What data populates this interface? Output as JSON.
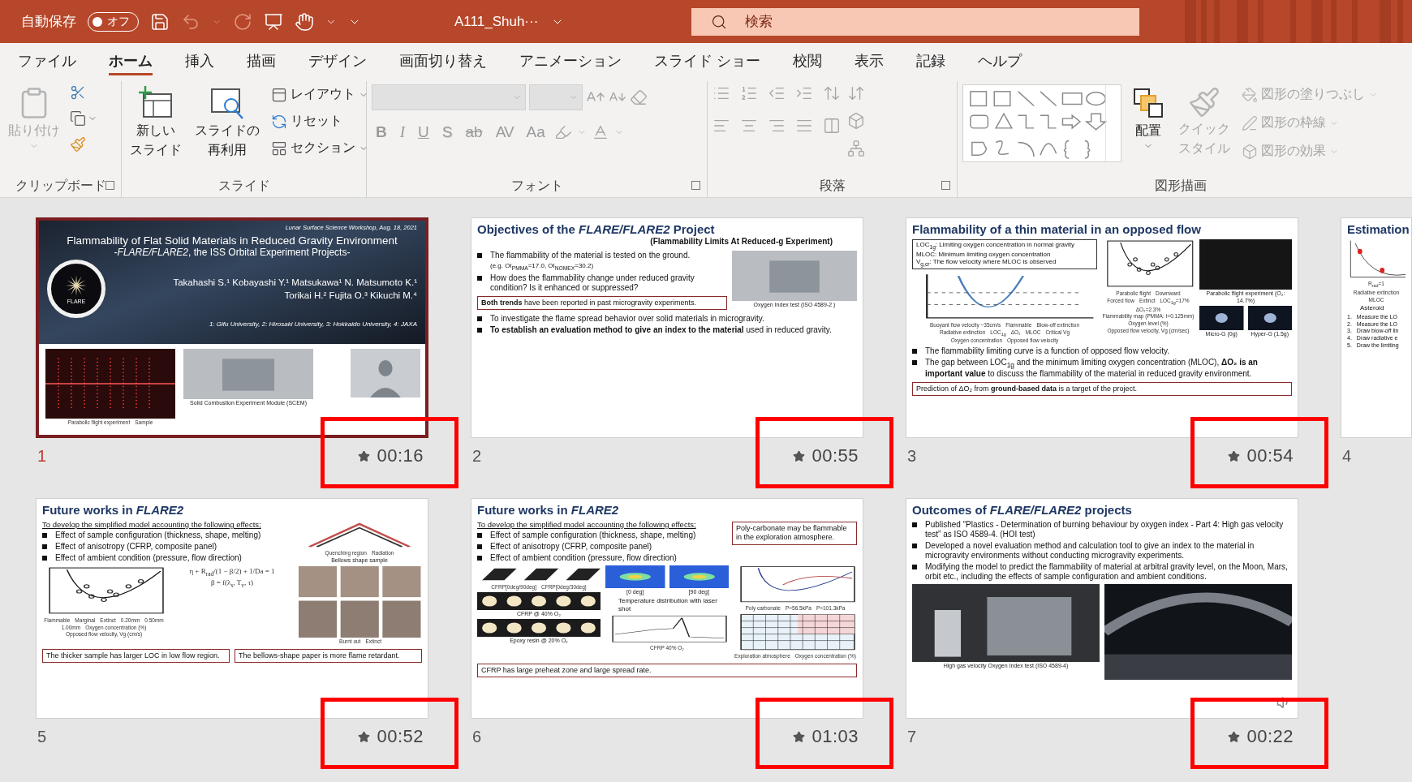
{
  "title_bar": {
    "autosave": {
      "label": "自動保存",
      "state": "オフ",
      "on": false
    },
    "filename": "A111_Shuh···",
    "search": {
      "placeholder": "検索"
    }
  },
  "tabs": [
    {
      "label": "ファイル",
      "selected": false
    },
    {
      "label": "ホーム",
      "selected": true
    },
    {
      "label": "挿入",
      "selected": false
    },
    {
      "label": "描画",
      "selected": false
    },
    {
      "label": "デザイン",
      "selected": false
    },
    {
      "label": "画面切り替え",
      "selected": false
    },
    {
      "label": "アニメーション",
      "selected": false
    },
    {
      "label": "スライド ショー",
      "selected": false
    },
    {
      "label": "校閲",
      "selected": false
    },
    {
      "label": "表示",
      "selected": false
    },
    {
      "label": "記録",
      "selected": false
    },
    {
      "label": "ヘルプ",
      "selected": false
    }
  ],
  "ribbon": {
    "clipboard": {
      "label": "クリップボード",
      "paste": {
        "label": "貼り付け",
        "disabled": true
      }
    },
    "slides_group": {
      "label": "スライド",
      "new_slide": [
        "新しい",
        "スライド"
      ],
      "reuse": [
        "スライドの",
        "再利用"
      ],
      "layout": "レイアウト",
      "reset": "リセット",
      "section": "セクション"
    },
    "font": {
      "label": "フォント",
      "disabled": true,
      "buttons": [
        {
          "text": "B",
          "kind": "bold"
        },
        {
          "text": "I",
          "kind": "italic"
        },
        {
          "text": "U",
          "kind": "underline"
        },
        {
          "text": "S",
          "kind": "shadow"
        },
        {
          "text": "ab",
          "kind": "strike"
        },
        {
          "text": "AV",
          "kind": "spacing"
        },
        {
          "text": "Aa",
          "kind": "case"
        }
      ]
    },
    "paragraph": {
      "label": "段落"
    },
    "drawing": {
      "label": "図形描画",
      "arrange": "配置",
      "quick_style": {
        "lines": [
          "クイック",
          "スタイル"
        ],
        "disabled": true
      },
      "format_items": [
        {
          "label": "図形の塗りつぶし",
          "disabled": true
        },
        {
          "label": "図形の枠線",
          "disabled": true
        },
        {
          "label": "図形の効果",
          "disabled": true
        }
      ]
    }
  },
  "slides": [
    {
      "kind": "title",
      "number": "1",
      "timing": "00:16",
      "selected": true,
      "highlighted": true,
      "event": "Lunar Surface Science Workshop, Aug. 18, 2021",
      "title": "Flammability of Flat Solid Materials in Reduced Gravity Environment",
      "subtitle": "-*FLARE/FLARE2*, the ISS Orbital Experiment Projects-",
      "authors": [
        "Takahashi S.¹ Kobayashi Y.¹ Matsukawa¹ N. Matsumoto K.¹",
        "Torikai H.² Fujita O.³ Kikuchi M.⁴"
      ],
      "affiliations": "1: Gifu University, 2: Hirosaki University, 3: Hokkaido University, 4: JAXA",
      "emblem_label": "FLARE",
      "figures": [
        {
          "kind": "flame-plot",
          "labels": [
            "Parabolic flight  experiment",
            "Sample"
          ]
        },
        {
          "kind": "photo",
          "caption": "Solid Combustion Experiment Module (SCEM)"
        },
        {
          "kind": "video"
        }
      ]
    },
    {
      "kind": "content",
      "number": "2",
      "timing": "00:55",
      "selected": false,
      "highlighted": true,
      "title": "Objectives of the *FLARE/FLARE2* Project",
      "subtitle": "(Flammability Limits At Reduced-g Experiment)",
      "rows": [
        {
          "columns": [
            {
              "blocks": [
                {
                  "kind": "bullet",
                  "text": "The flammability of the material is tested on the ground."
                },
                {
                  "kind": "sub",
                  "text": "(e.g. OI$_{PMMA}$=17.0, OI$_{NOMEX}$=30.2)"
                },
                {
                  "kind": "bullet",
                  "text": "How does the flammability change under reduced gravity condition?  Is it enhanced or suppressed?"
                },
                {
                  "kind": "note",
                  "text": "**Both trends** have been reported in past microgravity experiments."
                }
              ]
            },
            {
              "blocks": [
                {
                  "kind": "figures",
                  "items": [
                    {
                      "kind": "photo",
                      "caption": "Oxygen Index test (ISO 4589-2 )"
                    }
                  ]
                }
              ]
            }
          ]
        },
        {
          "columns": [
            {
              "blocks": [
                {
                  "kind": "bullet",
                  "text": "To investigate the flame spread behavior over solid materials in microgravity."
                },
                {
                  "kind": "bullet",
                  "text": "**To establish an evaluation method to give an index to the material** used in reduced gravity."
                }
              ]
            }
          ]
        }
      ]
    },
    {
      "kind": "content",
      "number": "3",
      "timing": "00:54",
      "selected": false,
      "highlighted": true,
      "title": "Flammability of a thin material in an opposed flow",
      "rows": [
        {
          "columns": [
            {
              "blocks": [
                {
                  "kind": "definitions",
                  "lines": [
                    "LOC$_{1g}$:  Limiting oxygen concentration in normal gravity",
                    "MLOC: Minimum limiting oxygen concentration",
                    "V$_{g,cr}$:    The flow velocity where MLOC is observed"
                  ]
                },
                {
                  "kind": "figures",
                  "items": [
                    {
                      "kind": "curve",
                      "labels": [
                        "Buoyant flow velocity ~35cm/s",
                        "Flammable",
                        "Blow-off extinction",
                        "Radiative extinction",
                        "LOC$_{1g}$",
                        "ΔO₂",
                        "MLOC",
                        "Critical Vg",
                        "Oxygen concentration",
                        "Opposed flow velocity"
                      ]
                    }
                  ]
                }
              ]
            },
            {
              "blocks": [
                {
                  "kind": "figures",
                  "items": [
                    {
                      "kind": "scatter",
                      "labels": [
                        "Parabolic flight",
                        "Downward",
                        "Forced flow",
                        "Extinct",
                        "LOC$_{1g}$=17%",
                        "ΔO₂=2.3%",
                        "Flammability map (PMMA: t=0.125mm)",
                        "Oxygen level (%)",
                        "Opposed flow velocity, Vg (cm/sec)"
                      ]
                    }
                  ]
                }
              ]
            },
            {
              "blocks": [
                {
                  "kind": "figures",
                  "items": [
                    {
                      "kind": "dark-photo",
                      "caption": "Parabolic flight experiment (O₂: 14.7%)"
                    }
                  ]
                },
                {
                  "kind": "figures",
                  "items": [
                    {
                      "kind": "small-photo",
                      "caption": "Micro-G (0g)"
                    },
                    {
                      "kind": "small-photo",
                      "caption": "Hyper-G (1.5g)"
                    }
                  ]
                }
              ]
            }
          ]
        },
        {
          "columns": [
            {
              "blocks": [
                {
                  "kind": "bullet",
                  "text": "The flammability limiting curve is a function of opposed flow velocity."
                },
                {
                  "kind": "bullet",
                  "text": "The gap between LOC$_{1g}$ and the minimum limiting oxygen concentration (MLOC), **ΔO₂ is an important value** to discuss the flammability of the material in reduced gravity environment."
                },
                {
                  "kind": "note",
                  "text": "Prediction of ΔO₂ from **ground-based data** is a target of the project."
                }
              ]
            }
          ]
        }
      ]
    },
    {
      "kind": "content",
      "number": "4",
      "selected": false,
      "title": "Estimation",
      "rows": [
        {
          "columns": [
            {
              "blocks": [
                {
                  "kind": "figures",
                  "items": [
                    {
                      "kind": "curve-cut",
                      "labels": [
                        "R$_{rad}$=1",
                        "Radiative extinction",
                        "MLOC"
                      ]
                    }
                  ]
                },
                {
                  "kind": "sub",
                  "text": "Asteroid"
                },
                {
                  "kind": "numbered",
                  "items": [
                    {
                      "n": "1.",
                      "text": "Measure the LO"
                    },
                    {
                      "n": "2.",
                      "text": "Measure the LO"
                    },
                    {
                      "n": "3.",
                      "text": "Draw blow-off lin"
                    },
                    {
                      "n": "4.",
                      "text": "Draw radiative e"
                    },
                    {
                      "n": "5.",
                      "text": "Draw the limiting"
                    }
                  ]
                }
              ]
            }
          ]
        }
      ]
    },
    {
      "kind": "content",
      "number": "5",
      "timing": "00:52",
      "selected": false,
      "highlighted": true,
      "title": "Future works in *FLARE2*",
      "rows": [
        {
          "columns": [
            {
              "blocks": [
                {
                  "kind": "underline",
                  "text": "To develop the simplified model accounting the following effects;"
                },
                {
                  "kind": "bullet",
                  "text": "Effect of sample configuration (thickness, shape, melting)"
                },
                {
                  "kind": "bullet",
                  "text": "Effect of anisotropy (CFRP, composite panel)"
                },
                {
                  "kind": "bullet",
                  "text": "Effect of ambient condition (pressure, flow direction)"
                }
              ]
            },
            {
              "blocks": [
                {
                  "kind": "figures",
                  "items": [
                    {
                      "kind": "zigzag",
                      "caption": "Bellows shape sample",
                      "labels": [
                        "Quenching region",
                        "Radiation"
                      ]
                    }
                  ]
                }
              ]
            }
          ]
        },
        {
          "columns": [
            {
              "blocks": [
                {
                  "kind": "figures",
                  "items": [
                    {
                      "kind": "scatter",
                      "labels": [
                        "Flammable",
                        "Marginal",
                        "Extinct",
                        "0.20mm",
                        "0.50mm",
                        "1.00mm",
                        "Oxygen concentration (%)",
                        "Opposed flow velocity, Vg (cm/s)"
                      ]
                    }
                  ]
                }
              ]
            },
            {
              "blocks": [
                {
                  "kind": "figures",
                  "items": [
                    {
                      "kind": "equation",
                      "labels": [
                        "η + R$_{rad}$/(1 − β/2) + 1/Da = 1",
                        "β = f(λ$_{s}$, T$_{v}$, τ)"
                      ]
                    }
                  ]
                }
              ]
            },
            {
              "blocks": [
                {
                  "kind": "figures",
                  "items": [
                    {
                      "kind": "photo-grid",
                      "labels": [
                        "Burnt out",
                        "Extinct"
                      ]
                    }
                  ]
                }
              ]
            }
          ]
        },
        {
          "columns": [
            {
              "blocks": [
                {
                  "kind": "note",
                  "text": "The thicker sample has larger LOC in low flow region."
                }
              ]
            },
            {
              "blocks": [
                {
                  "kind": "note",
                  "text": "The bellows-shape paper is more flame retardant."
                }
              ]
            }
          ]
        }
      ]
    },
    {
      "kind": "content",
      "number": "6",
      "timing": "01:03",
      "selected": false,
      "highlighted": true,
      "title": "Future works in *FLARE2*",
      "rows": [
        {
          "columns": [
            {
              "blocks": [
                {
                  "kind": "underline",
                  "text": "To develop the simplified model accounting the following effects;"
                },
                {
                  "kind": "bullet",
                  "text": "Effect of sample configuration (thickness, shape, melting)"
                },
                {
                  "kind": "bullet",
                  "text": "Effect of anisotropy (CFRP, composite panel)"
                },
                {
                  "kind": "bullet",
                  "text": "Effect of ambient condition (pressure, flow direction)"
                }
              ]
            },
            {
              "blocks": [
                {
                  "kind": "note",
                  "text": "Poly-carbonate may be flammable in the exploration atmosphere."
                }
              ]
            }
          ]
        },
        {
          "columns": [
            {
              "blocks": [
                {
                  "kind": "figures",
                  "items": [
                    {
                      "kind": "stripes",
                      "labels": [
                        "CFRP[0deg/90deg]",
                        "CFRP[0deg/30deg]"
                      ]
                    }
                  ]
                },
                {
                  "kind": "figures",
                  "items": [
                    {
                      "kind": "flames",
                      "caption": "CFRP @ 40% O₂"
                    }
                  ]
                },
                {
                  "kind": "figures",
                  "items": [
                    {
                      "kind": "flames",
                      "caption": "Epoxy resin @ 20% O₂"
                    }
                  ]
                }
              ]
            },
            {
              "blocks": [
                {
                  "kind": "figures",
                  "items": [
                    {
                      "kind": "heatmap",
                      "caption": "[0 deg]"
                    },
                    {
                      "kind": "heatmap",
                      "caption": "[90 deg]"
                    }
                  ]
                },
                {
                  "kind": "sub",
                  "text": "Temperature distribution with laser shot"
                },
                {
                  "kind": "figures",
                  "items": [
                    {
                      "kind": "curve-peak",
                      "labels": [
                        "CFRP 40% O₂"
                      ]
                    }
                  ]
                }
              ]
            },
            {
              "blocks": [
                {
                  "kind": "figures",
                  "items": [
                    {
                      "kind": "chart",
                      "labels": [
                        "Poly carbonate",
                        "P=56.5kPa",
                        "P=101.3kPa"
                      ]
                    }
                  ]
                },
                {
                  "kind": "figures",
                  "items": [
                    {
                      "kind": "grid",
                      "labels": [
                        "Exploration atmosphere",
                        "Oxygen concentration (%)"
                      ]
                    }
                  ]
                }
              ]
            }
          ]
        },
        {
          "columns": [
            {
              "blocks": [
                {
                  "kind": "note",
                  "text": "CFRP has large preheat zone and large spread rate."
                }
              ]
            }
          ]
        }
      ]
    },
    {
      "kind": "content",
      "number": "7",
      "timing": "00:22",
      "selected": false,
      "highlighted": true,
      "audio": true,
      "title": "Outcomes of *FLARE/FLARE2* projects",
      "rows": [
        {
          "columns": [
            {
              "blocks": [
                {
                  "kind": "bullet",
                  "text": "Published “Plastics - Determination of burning behaviour by oxygen index - Part 4: High gas velocity test” as ISO 4589-4. (HOI test)"
                },
                {
                  "kind": "bullet",
                  "text": "Developed a novel evaluation method and calculation tool to give an index to the material in microgravity environments without conducting microgravity experiments."
                },
                {
                  "kind": "bullet",
                  "text": "Modifying the model to predict the flammability of material at arbitral gravity level, on the Moon, Mars, orbit etc., including the effects of sample configuration and ambient conditions."
                }
              ]
            }
          ]
        },
        {
          "columns": [
            {
              "blocks": [
                {
                  "kind": "figures",
                  "items": [
                    {
                      "kind": "lab-photo",
                      "caption": "High gas velocity Oxygen Index test (ISO 4589-4)"
                    }
                  ]
                }
              ]
            },
            {
              "blocks": [
                {
                  "kind": "figures",
                  "items": [
                    {
                      "kind": "poster"
                    }
                  ]
                }
              ]
            }
          ]
        }
      ]
    }
  ]
}
